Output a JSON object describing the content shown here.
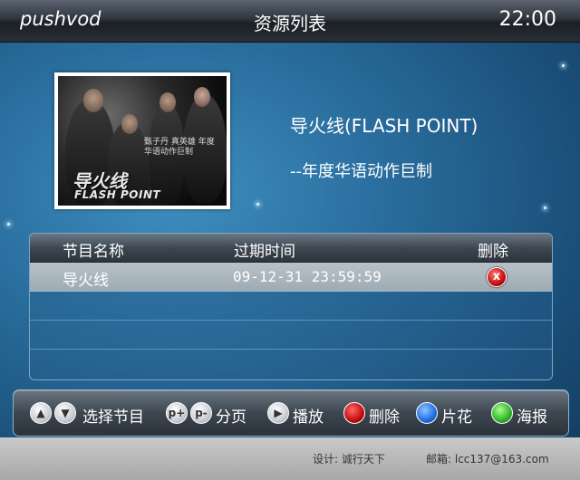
{
  "header": {
    "brand": "pushvod",
    "title": "资源列表",
    "clock": "22:00"
  },
  "poster": {
    "title_cn": "导火线",
    "title_en": "FLASH POINT",
    "tagline": "甄子丹 真英雄 年度华语动作巨制"
  },
  "detail": {
    "title": "导火线(FLASH POINT)",
    "subtitle": "--年度华语动作巨制"
  },
  "table": {
    "headers": {
      "name": "节目名称",
      "expire": "过期时间",
      "delete": "删除"
    },
    "rows": [
      {
        "name": "导火线",
        "expire": "09-12-31 23:59:59",
        "delete_icon": "x"
      }
    ]
  },
  "legend": {
    "select": "选择节目",
    "page": "分页",
    "play": "播放",
    "delete": "删除",
    "clip": "片花",
    "poster": "海报",
    "page_up_symbol": "p+",
    "page_down_symbol": "p-"
  },
  "footer": {
    "design": "设计: 诚行天下",
    "email": "邮箱: lcc137@163.com"
  },
  "colors": {
    "red": "#c60b0b",
    "blue": "#1e6ce0",
    "green": "#2fb32a"
  }
}
